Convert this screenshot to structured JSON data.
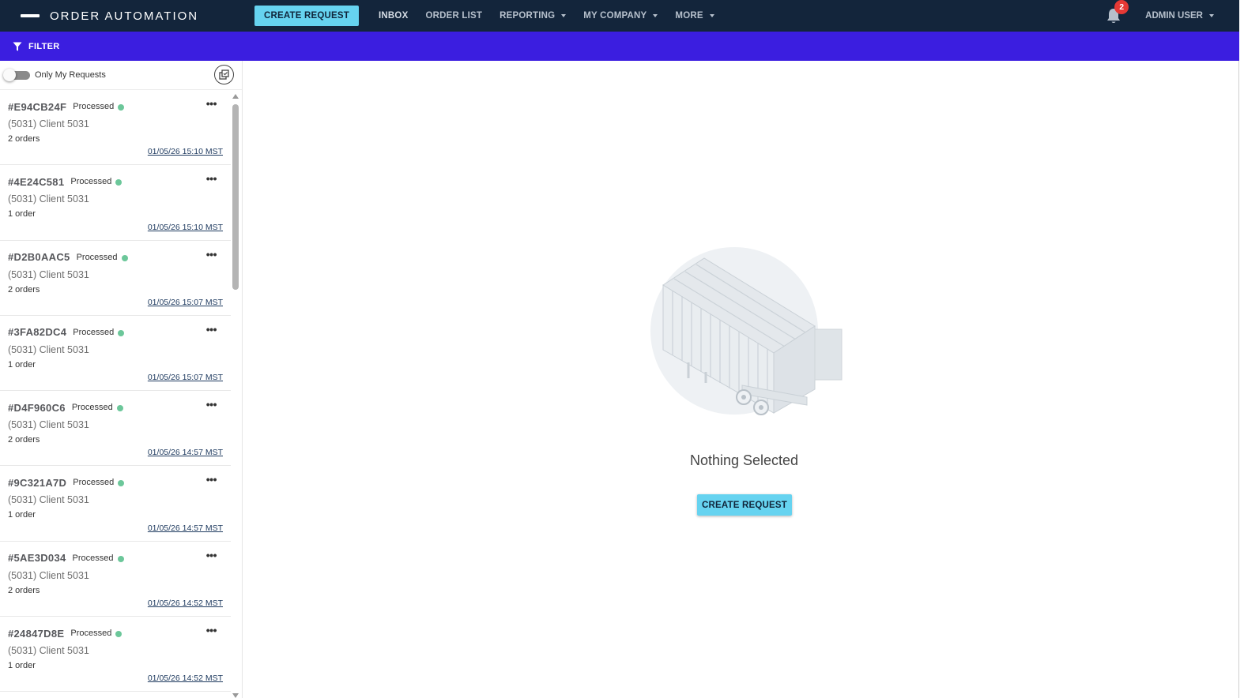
{
  "app": {
    "title": "ORDER AUTOMATION"
  },
  "topnav": {
    "create_request_label": "CREATE REQUEST",
    "items": [
      {
        "label": "INBOX",
        "has_dropdown": false
      },
      {
        "label": "ORDER LIST",
        "has_dropdown": false
      },
      {
        "label": "REPORTING",
        "has_dropdown": true
      },
      {
        "label": "MY COMPANY",
        "has_dropdown": true
      },
      {
        "label": "MORE",
        "has_dropdown": true
      }
    ],
    "notifications_count": "2",
    "user_label": "ADMIN USER"
  },
  "filterbar": {
    "label": "FILTER"
  },
  "sidebar": {
    "toggle_label": "Only My Requests",
    "toggle_on": false,
    "requests": [
      {
        "id": "#E94CB24F",
        "status": "Processed",
        "client": "(5031) Client 5031",
        "orders": "2 orders",
        "timestamp": "01/05/26 15:10 MST"
      },
      {
        "id": "#4E24C581",
        "status": "Processed",
        "client": "(5031) Client 5031",
        "orders": "1 order",
        "timestamp": "01/05/26 15:10 MST"
      },
      {
        "id": "#D2B0AAC5",
        "status": "Processed",
        "client": "(5031) Client 5031",
        "orders": "2 orders",
        "timestamp": "01/05/26 15:07 MST"
      },
      {
        "id": "#3FA82DC4",
        "status": "Processed",
        "client": "(5031) Client 5031",
        "orders": "1 order",
        "timestamp": "01/05/26 15:07 MST"
      },
      {
        "id": "#D4F960C6",
        "status": "Processed",
        "client": "(5031) Client 5031",
        "orders": "2 orders",
        "timestamp": "01/05/26 14:57 MST"
      },
      {
        "id": "#9C321A7D",
        "status": "Processed",
        "client": "(5031) Client 5031",
        "orders": "1 order",
        "timestamp": "01/05/26 14:57 MST"
      },
      {
        "id": "#5AE3D034",
        "status": "Processed",
        "client": "(5031) Client 5031",
        "orders": "2 orders",
        "timestamp": "01/05/26 14:52 MST"
      },
      {
        "id": "#24847D8E",
        "status": "Processed",
        "client": "(5031) Client 5031",
        "orders": "1 order",
        "timestamp": "01/05/26 14:52 MST"
      }
    ]
  },
  "main": {
    "empty_text": "Nothing Selected",
    "create_request_label": "CREATE REQUEST",
    "illustration_icon": "truck-trailer-icon"
  },
  "colors": {
    "topbar": "#13253b",
    "filterbar": "#3b1ee0",
    "accent_button": "#66d3f0",
    "status_processed": "#6cc79a",
    "badge": "#e53935"
  }
}
